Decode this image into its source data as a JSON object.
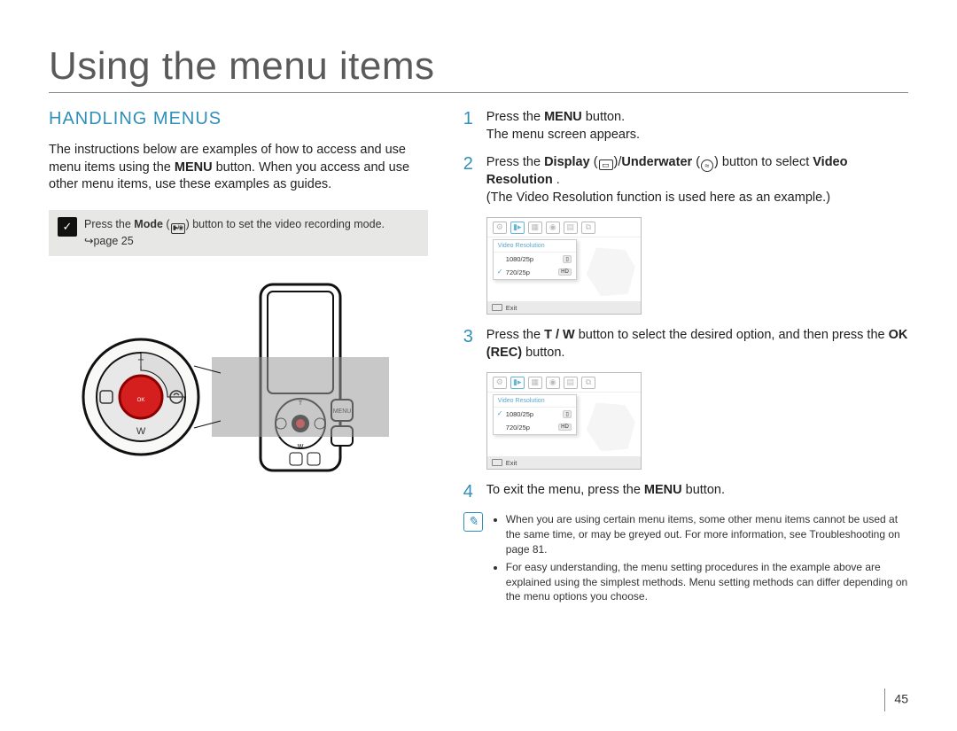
{
  "page": {
    "title": "Using the menu items",
    "number": "45"
  },
  "left": {
    "section_heading": "HANDLING MENUS",
    "intro": "The instructions below are examples of how to access and use menu items using the MENU button. When you access and use other menu items, use these examples as guides.",
    "intro_bold": "MENU",
    "tip_prefix": "Press the ",
    "tip_bold": "Mode",
    "tip_mid": " (",
    "tip_icons_alt": "video/photo",
    "tip_suffix_after_icons": ") button to set the video recording mode.",
    "tip_pageref": "page 25",
    "dpad_labels": {
      "top": "T",
      "bottom": "W",
      "center": "OK"
    },
    "menu_button_label": "MENU"
  },
  "steps": [
    {
      "n": "1",
      "parts": [
        "Press the ",
        {
          "b": "MENU"
        },
        " button."
      ],
      "after": "The menu screen appears."
    },
    {
      "n": "2",
      "parts": [
        "Press the ",
        {
          "b": "Display"
        },
        " (",
        {
          "icon": "display-icon"
        },
        ")/",
        {
          "b": "Underwater"
        },
        " (",
        {
          "icon": "underwater-icon"
        },
        ") button to select ",
        {
          "b": "Video Resolution"
        },
        " ."
      ],
      "after": "(The Video Resolution function is used here as an example.)",
      "screenshot": {
        "header": "Video Resolution",
        "rows": [
          {
            "label": "1080/25p",
            "tag": "",
            "selected": false
          },
          {
            "label": "720/25p",
            "tag": "HD",
            "selected": true
          }
        ],
        "exit": "Exit"
      }
    },
    {
      "n": "3",
      "parts": [
        "Press the ",
        {
          "b": "T / W"
        },
        " button to select the desired option, and then press the ",
        {
          "b": "OK (REC)"
        },
        " button."
      ],
      "screenshot": {
        "header": "Video Resolution",
        "rows": [
          {
            "label": "1080/25p",
            "tag": "",
            "selected": true
          },
          {
            "label": "720/25p",
            "tag": "HD",
            "selected": false
          }
        ],
        "exit": "Exit"
      }
    },
    {
      "n": "4",
      "parts": [
        "To exit the menu, press the ",
        {
          "b": "MENU"
        },
        " button."
      ]
    }
  ],
  "notes": [
    "When you are using certain menu items, some other menu items cannot be used at the same time, or may be greyed out. For more information, see Troubleshooting on page 81.",
    "For easy understanding, the menu setting procedures in the example above are explained using the simplest methods. Menu setting methods can differ depending on the menu options you choose."
  ]
}
